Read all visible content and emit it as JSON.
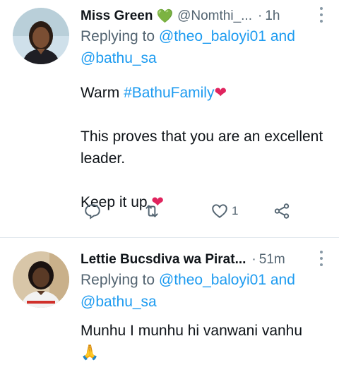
{
  "tweets": [
    {
      "name": "Miss Green",
      "name_emoji": "💚",
      "handle": "@Nomthi_...",
      "separator": "·",
      "time": "1h",
      "replying_prefix": "Replying to",
      "reply_to_1": "@theo_baloyi01",
      "reply_and": "and",
      "reply_to_2": "@bathu_sa",
      "line1_prefix": "Warm",
      "hashtag": "#BathuFamily",
      "line1_emoji": "❤",
      "line2": "This proves that you are an excellent leader.",
      "line3": "Keep it up",
      "line3_emoji": "❤",
      "like_count": "1",
      "icons": [
        "reply-icon",
        "retweet-icon",
        "like-icon",
        "share-icon"
      ]
    },
    {
      "name": "Lettie Bucsdiva wa Pirat...",
      "separator": "·",
      "time": "51m",
      "replying_prefix": "Replying to",
      "reply_to_1": "@theo_baloyi01",
      "reply_and": "and",
      "reply_to_2": "@bathu_sa",
      "line1": "Munhu I munhu hi vanwani vanhu",
      "line1_emoji": "🙏"
    }
  ],
  "colors": {
    "link": "#1d9bf0",
    "secondary": "#536471",
    "heart": "#e0245e",
    "green_heart": "#4cae4c"
  }
}
